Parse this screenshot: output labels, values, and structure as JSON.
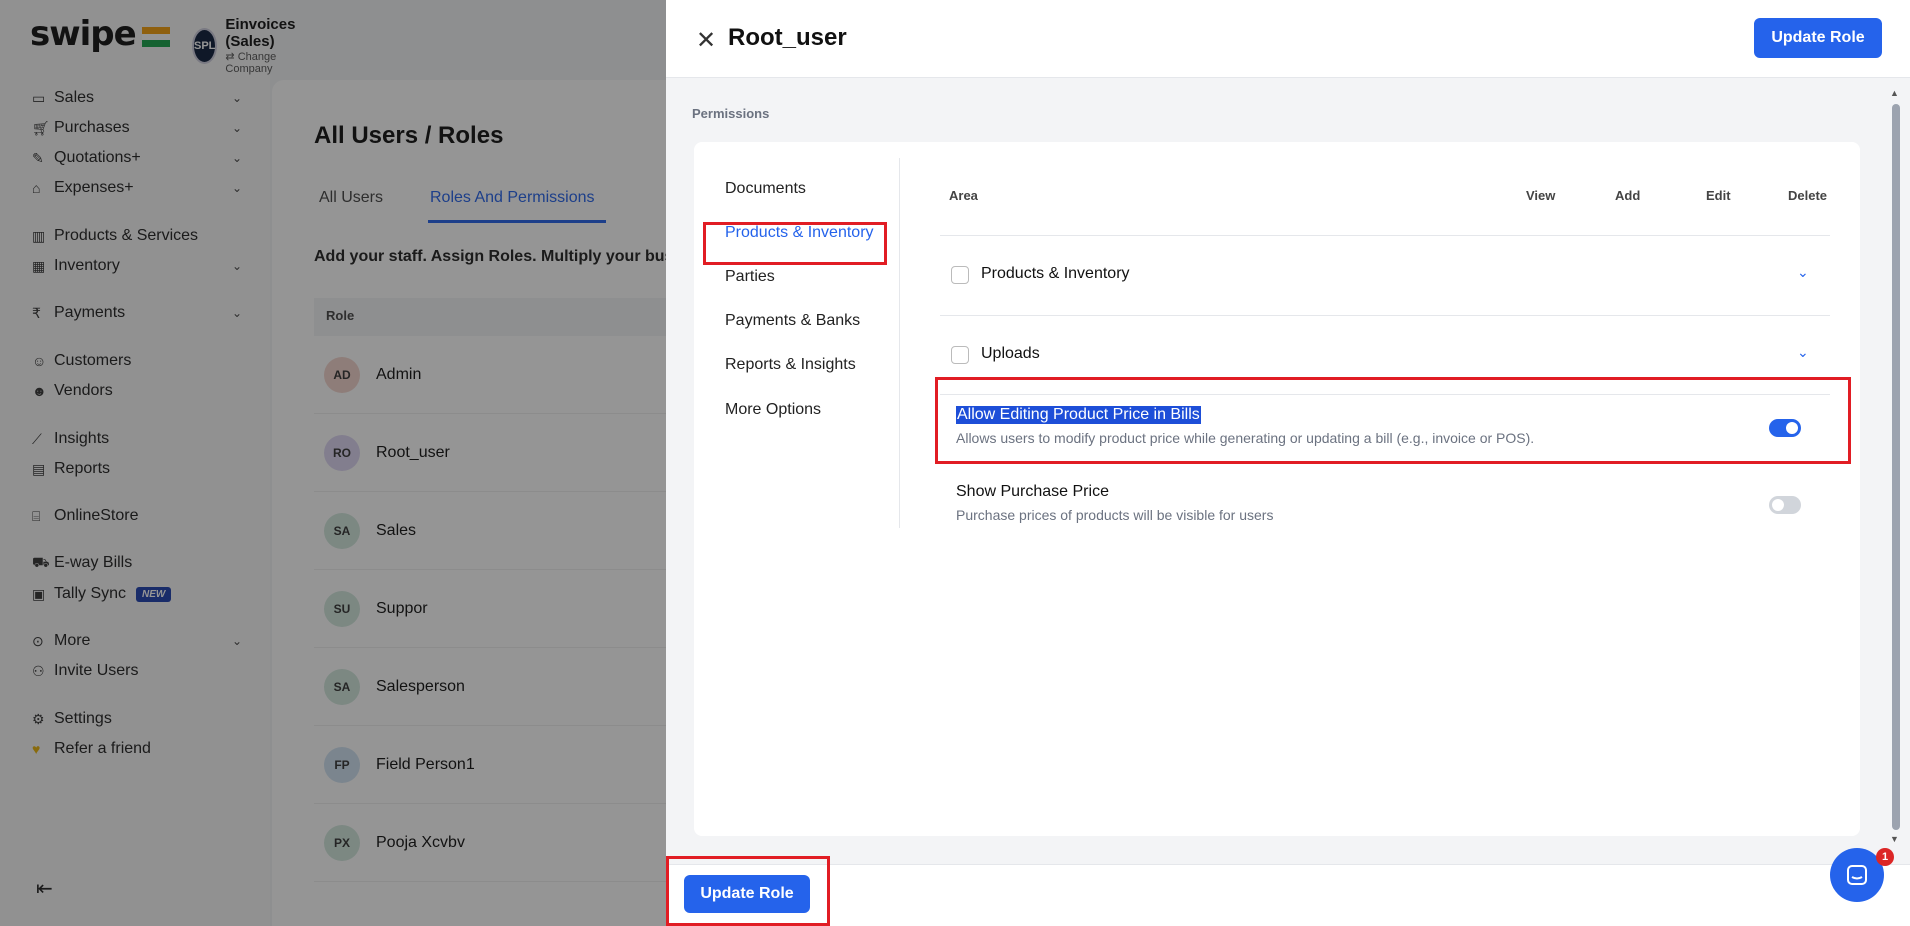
{
  "brand": {
    "name": "swipe"
  },
  "company": {
    "logo_text": "SPL",
    "name": "Einvoices (Sales)",
    "change_label": "Change Company"
  },
  "sidebar": {
    "items": [
      {
        "label": "Sales",
        "icon": "money-icon",
        "chevron": true
      },
      {
        "label": "Purchases",
        "icon": "cart-icon",
        "chevron": true
      },
      {
        "label": "Quotations+",
        "icon": "pen-icon",
        "chevron": true
      },
      {
        "label": "Expenses+",
        "icon": "tag-icon",
        "chevron": true
      },
      {
        "label": "Products & Services",
        "icon": "barcode-icon",
        "chevron": false
      },
      {
        "label": "Inventory",
        "icon": "warehouse-icon",
        "chevron": true
      },
      {
        "label": "Payments",
        "icon": "rupee-icon",
        "chevron": true
      },
      {
        "label": "Customers",
        "icon": "user-icon",
        "chevron": false
      },
      {
        "label": "Vendors",
        "icon": "users-icon",
        "chevron": false
      },
      {
        "label": "Insights",
        "icon": "chart-icon",
        "chevron": false
      },
      {
        "label": "Reports",
        "icon": "report-icon",
        "chevron": false
      },
      {
        "label": "OnlineStore",
        "icon": "store-icon",
        "chevron": false
      },
      {
        "label": "E-way Bills",
        "icon": "truck-icon",
        "chevron": false
      },
      {
        "label": "Tally Sync",
        "icon": "sync-icon",
        "chevron": false,
        "badge": "NEW"
      },
      {
        "label": "More",
        "icon": "more-icon",
        "chevron": true
      },
      {
        "label": "Invite Users",
        "icon": "user-plus-icon",
        "chevron": false
      },
      {
        "label": "Settings",
        "icon": "gear-icon",
        "chevron": false
      },
      {
        "label": "Refer a friend",
        "icon": "heart-hand-icon",
        "chevron": false
      }
    ]
  },
  "main": {
    "title": "All Users / Roles",
    "tabs": [
      {
        "label": "All Users"
      },
      {
        "label": "Roles And Permissions"
      }
    ],
    "subtitle": "Add your staff. Assign Roles. Multiply your bus",
    "table_header": "Role",
    "roles": [
      {
        "initials": "AD",
        "name": "Admin",
        "color": "#f3d4cc"
      },
      {
        "initials": "RO",
        "name": "Root_user",
        "color": "#ddd6f3"
      },
      {
        "initials": "SA",
        "name": "Sales",
        "color": "#d1e7dd"
      },
      {
        "initials": "SU",
        "name": "Suppor",
        "color": "#d1e7dd"
      },
      {
        "initials": "SA",
        "name": "Salesperson",
        "color": "#d1e7dd"
      },
      {
        "initials": "FP",
        "name": "Field Person1",
        "color": "#cfe2f3"
      },
      {
        "initials": "PX",
        "name": "Pooja Xcvbv",
        "color": "#d1e7dd"
      }
    ]
  },
  "drawer": {
    "title": "Root_user",
    "update_label": "Update Role",
    "permissions_label": "Permissions",
    "categories": [
      {
        "label": "Documents",
        "active": false
      },
      {
        "label": "Products & Inventory",
        "active": true
      },
      {
        "label": "Parties",
        "active": false
      },
      {
        "label": "Payments & Banks",
        "active": false
      },
      {
        "label": "Reports & Insights",
        "active": false
      },
      {
        "label": "More Options",
        "active": false
      }
    ],
    "columns": {
      "area": "Area",
      "view": "View",
      "add": "Add",
      "edit": "Edit",
      "delete": "Delete"
    },
    "areas": [
      {
        "label": "Products & Inventory"
      },
      {
        "label": "Uploads"
      }
    ],
    "options": [
      {
        "title": "Allow Editing Product Price in Bills",
        "desc": "Allows users to modify product price while generating or updating a bill (e.g., invoice or POS).",
        "enabled": true
      },
      {
        "title": "Show Purchase Price",
        "desc": "Purchase prices of products will be visible for users",
        "enabled": false
      }
    ]
  },
  "chat": {
    "badge_count": "1"
  },
  "colors": {
    "accent": "#2563eb",
    "highlight_box": "#e11d24"
  }
}
